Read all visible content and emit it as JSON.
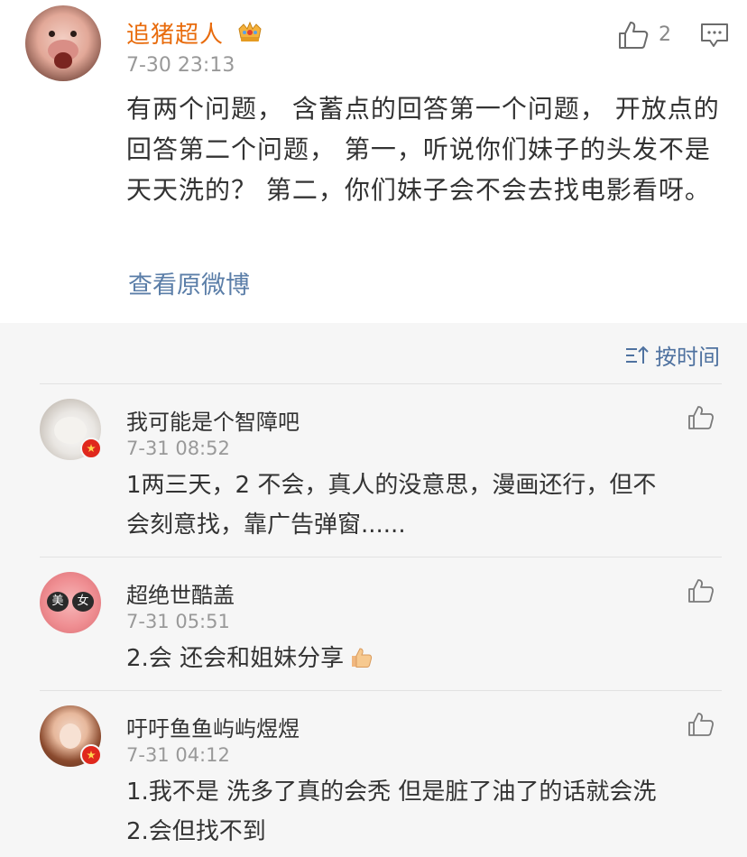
{
  "post": {
    "author": "追猪超人",
    "time": "7-30 23:13",
    "like_count": "2",
    "text": "有两个问题， 含蓄点的回答第一个问题， 开放点的回答第二个问题， 第一，听说你们妹子的头发不是天天洗的？ 第二，你们妹子会不会去找电影看呀。",
    "view_original": "查看原微博",
    "author_color": "#e86b0c",
    "link_color": "#5b7ea8"
  },
  "comments_header": {
    "sort_label": "按时间"
  },
  "comments": [
    {
      "name": "我可能是个智障吧",
      "time": "7-31 08:52",
      "text_line1": "1两三天，2 不会，真人的没意思，漫画还行，但不",
      "text_line2": "会刻意找，靠广告弹窗......"
    },
    {
      "name": "超绝世酷盖",
      "time": "7-31 05:51",
      "text": "2.会 还会和姐妹分享",
      "emoji": "thumbs-up-emoji",
      "avatar_glasses_left": "美",
      "avatar_glasses_right": "女"
    },
    {
      "name": "吁吁鱼鱼屿屿煜煜",
      "time": "7-31 04:12",
      "text_line1": "1.我不是 洗多了真的会秃 但是脏了油了的话就会洗",
      "text_line2": "2.会但找不到"
    }
  ]
}
